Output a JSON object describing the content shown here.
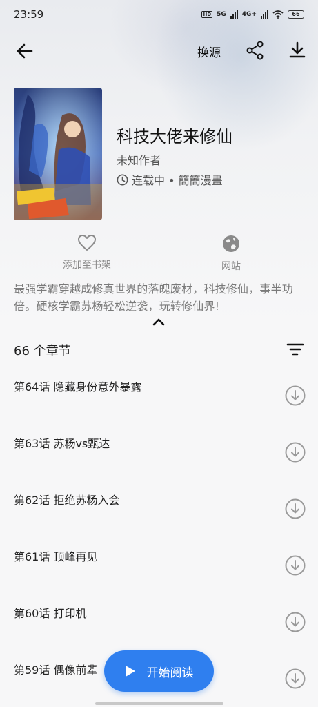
{
  "status_bar": {
    "time": "23:59",
    "battery": "66",
    "net1": "5G",
    "net2": "4G+"
  },
  "toolbar": {
    "change_source": "换源"
  },
  "book": {
    "title": "科技大佬来修仙",
    "author": "未知作者",
    "status": "连载中 • 簡簡漫畫",
    "description": "最强学霸穿越成修真世界的落魄废材，科技修仙，事半功倍。硬核学霸苏杨轻松逆袭，玩转修仙界!"
  },
  "actions": {
    "add_shelf": "添加至书架",
    "website": "网站"
  },
  "chapters": {
    "count_label": "66 个章节",
    "items": [
      {
        "title": "第64话 隐藏身份意外暴露"
      },
      {
        "title": "第63话 苏杨vs甄达"
      },
      {
        "title": "第62话 拒绝苏杨入会"
      },
      {
        "title": "第61话 顶峰再见"
      },
      {
        "title": "第60话 打印机"
      },
      {
        "title": "第59话 偶像前辈"
      }
    ]
  },
  "fab": {
    "label": "开始阅读"
  },
  "colors": {
    "accent": "#2f7fef",
    "text": "#1e1e1e",
    "muted": "#7a7a7a"
  }
}
